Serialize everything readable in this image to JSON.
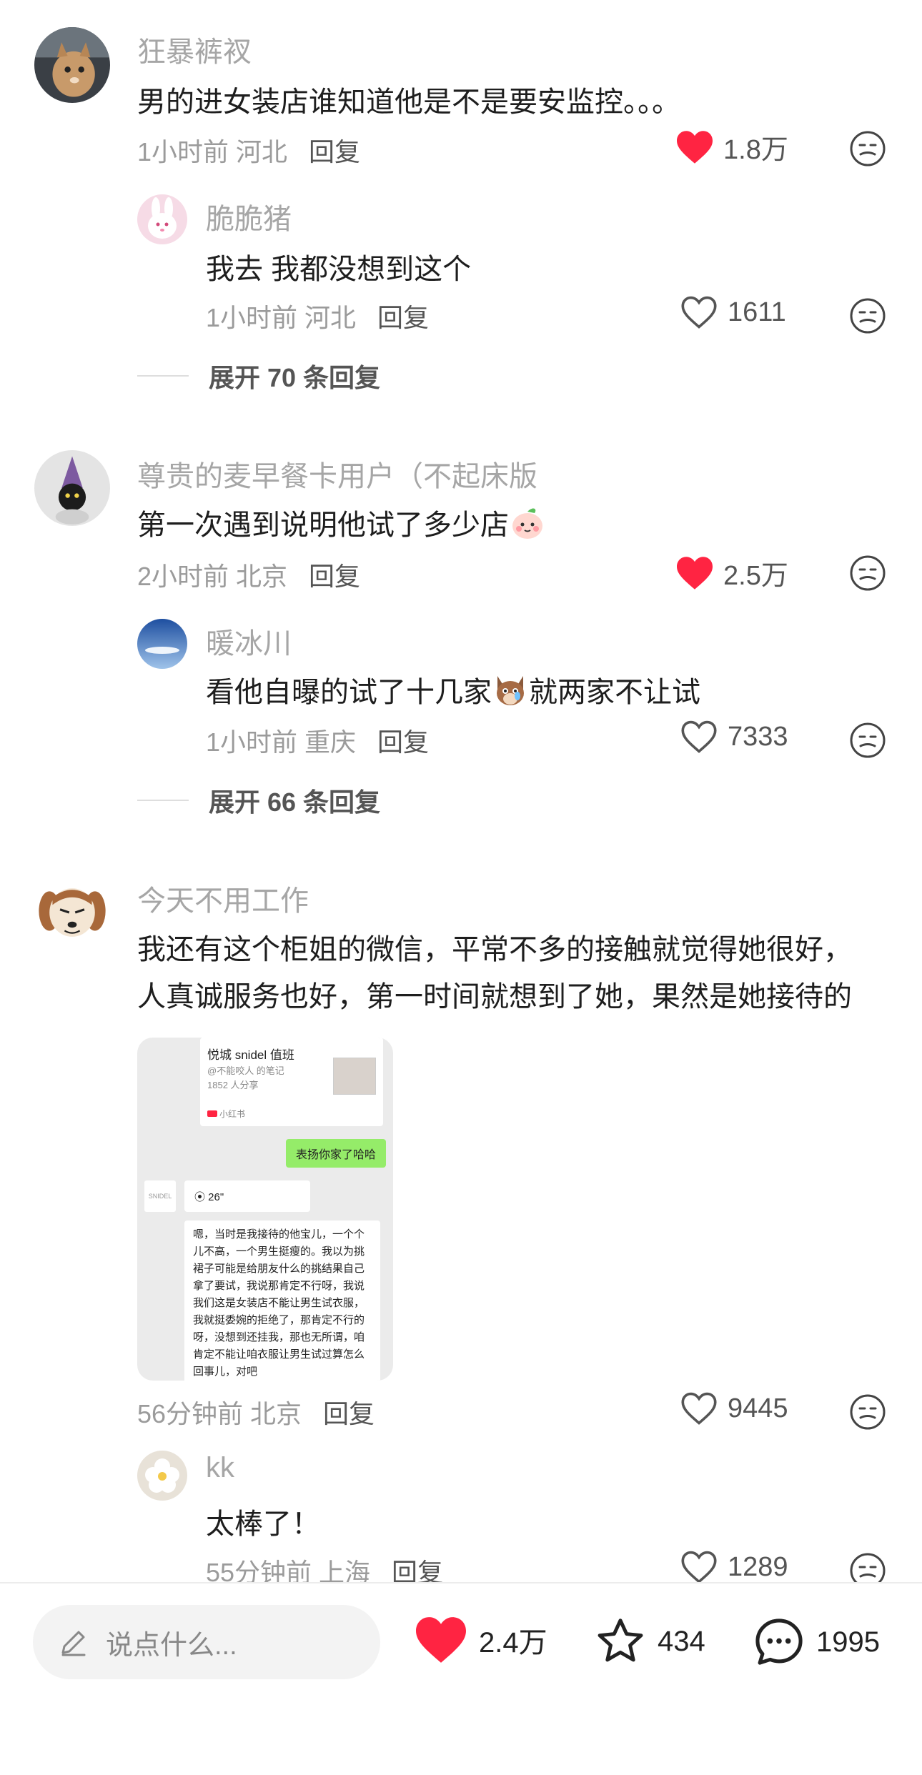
{
  "colors": {
    "like_red": "#ff2442",
    "muted": "#9b9b9b",
    "reply": "#555555"
  },
  "comments": [
    {
      "user": "狂暴裤衩",
      "text": "男的进女装店谁知道他是不是要安监控。。。",
      "time_loc": "1小时前 河北",
      "reply_label": "回复",
      "likes": "1.8万",
      "liked": true,
      "replies": [
        {
          "user": "脆脆猪",
          "text": "我去 我都没想到这个",
          "time_loc": "1小时前 河北",
          "reply_label": "回复",
          "likes": "1611",
          "liked": false
        }
      ],
      "expand_label": "展开 70 条回复"
    },
    {
      "user": "尊贵的麦早餐卡用户（不起床版",
      "text": "第一次遇到说明他试了多少店",
      "time_loc": "2小时前 北京",
      "reply_label": "回复",
      "likes": "2.5万",
      "liked": true,
      "replies": [
        {
          "user": "暖冰川",
          "text_a": "看他自曝的试了十几家",
          "text_b": "就两家不让试",
          "time_loc": "1小时前 重庆",
          "reply_label": "回复",
          "likes": "7333",
          "liked": false
        }
      ],
      "expand_label": "展开 66 条回复"
    },
    {
      "user": "今天不用工作",
      "text_line1": "我还有这个柜姐的微信，平常不多的接触就觉得她很好，",
      "text_line2": "人真诚服务也好，第一时间就想到了她，果然是她接待的",
      "image": {
        "card_title": "悦城 snidel 值班",
        "card_author": "@不能咬人 的笔记",
        "card_shares": "1852 人分享",
        "card_source": "小红书",
        "green_bubble": "表扬你家了哈哈",
        "logo_text": "SNIDEL",
        "voice": "26\"",
        "message": "嗯，当时是我接待的他宝儿，一个个儿不高，一个男生挺瘦的。我以为挑裙子可能是给朋友什么的挑结果自己拿了要试，我说那肯定不行呀，我说我们这是女装店不能让男生试衣服，我就挺委婉的拒绝了，那肯定不行的呀，没想到还挂我，那也无所谓，咱肯定不能让咱衣服让男生试过算怎么回事儿，对吧"
      },
      "time_loc": "56分钟前 北京",
      "reply_label": "回复",
      "likes": "9445",
      "liked": false,
      "replies": [
        {
          "user": "kk",
          "text": "太棒了！",
          "time_loc": "55分钟前 上海",
          "reply_label": "回复",
          "likes": "1289",
          "liked": false
        }
      ]
    }
  ],
  "bottom_bar": {
    "input_placeholder": "说点什么...",
    "likes": "2.4万",
    "collects": "434",
    "comments": "1995"
  }
}
